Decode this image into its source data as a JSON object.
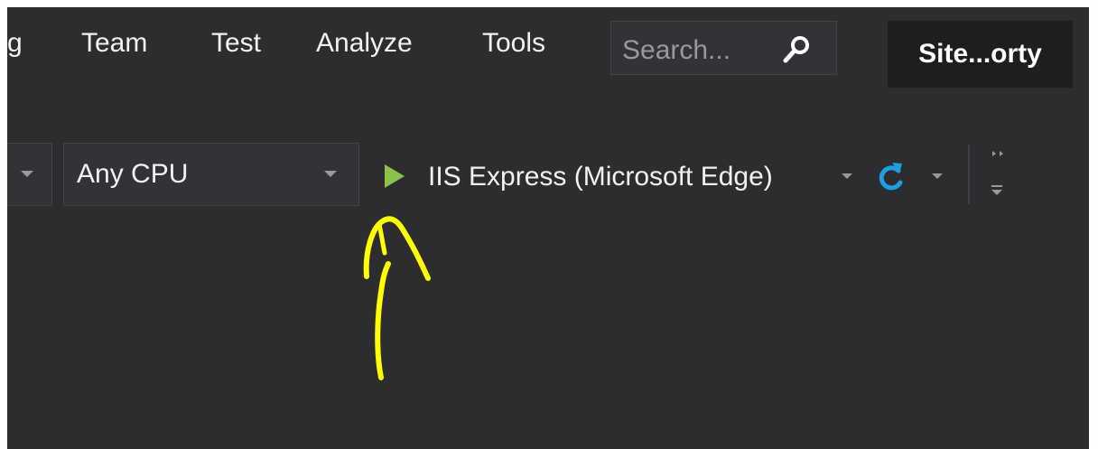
{
  "menu": {
    "items": [
      {
        "label": "g"
      },
      {
        "label": "Team"
      },
      {
        "label": "Test"
      },
      {
        "label": "Analyze"
      },
      {
        "label": "Tools"
      }
    ]
  },
  "search": {
    "placeholder": "Search...",
    "icon": "search-icon"
  },
  "solution": {
    "name": "Site...orty"
  },
  "toolbar": {
    "platform_value": "Any CPU",
    "run_target": "IIS Express (Microsoft Edge)",
    "icons": [
      "play-icon",
      "refresh-icon",
      "toolbar-overflow-icon"
    ]
  },
  "colors": {
    "background": "#2d2d30",
    "text": "#f1f1f1",
    "play": "#8bc34a",
    "refresh": "#1ba1e2",
    "annotation": "#ffff00"
  }
}
